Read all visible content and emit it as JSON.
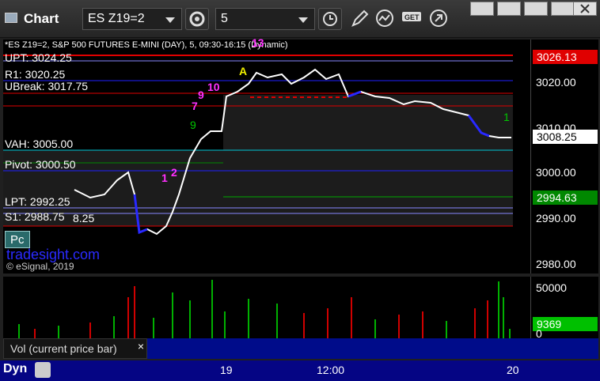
{
  "window": {
    "title": "Chart",
    "symbol": "ES Z19=2",
    "interval": "5"
  },
  "chart": {
    "heading": "*ES Z19=2, S&P 500 FUTURES E-MINI (DAY), 5, 09:30-16:15 (Dynamic)",
    "levels": [
      {
        "label": "UPT: 3024.25"
      },
      {
        "label": "R1: 3020.25"
      },
      {
        "label": "UBreak: 3017.75"
      },
      {
        "label": "VAH: 3005.00"
      },
      {
        "label": "Pivot: 3000.50"
      },
      {
        "label": "LPT: 2992.25"
      },
      {
        "label": "S1: 2988.75"
      }
    ],
    "price_axis": [
      "3020.00",
      "3010.00",
      "3000.00",
      "2990.00",
      "2980.00"
    ],
    "badges": {
      "upper": "3026.13",
      "last": "3008.25",
      "green": "2994.63"
    },
    "watermark": "tradesight.com",
    "copyright": "© eSignal, 2019",
    "pc_button": "Pc",
    "annotations": {
      "n13": "13",
      "n10": "10",
      "n9a": "9",
      "n7": "7",
      "n1": "1",
      "n2": "2",
      "n9b": "9",
      "nA": "A",
      "n1r": "1",
      "n825": "8.25"
    }
  },
  "volume": {
    "label": "Vol (current price bar)",
    "axis": [
      "50000",
      "9369",
      "0"
    ]
  },
  "time_axis": {
    "ticks": [
      "19",
      "12:00",
      "20"
    ],
    "dyn": "Dyn"
  }
}
